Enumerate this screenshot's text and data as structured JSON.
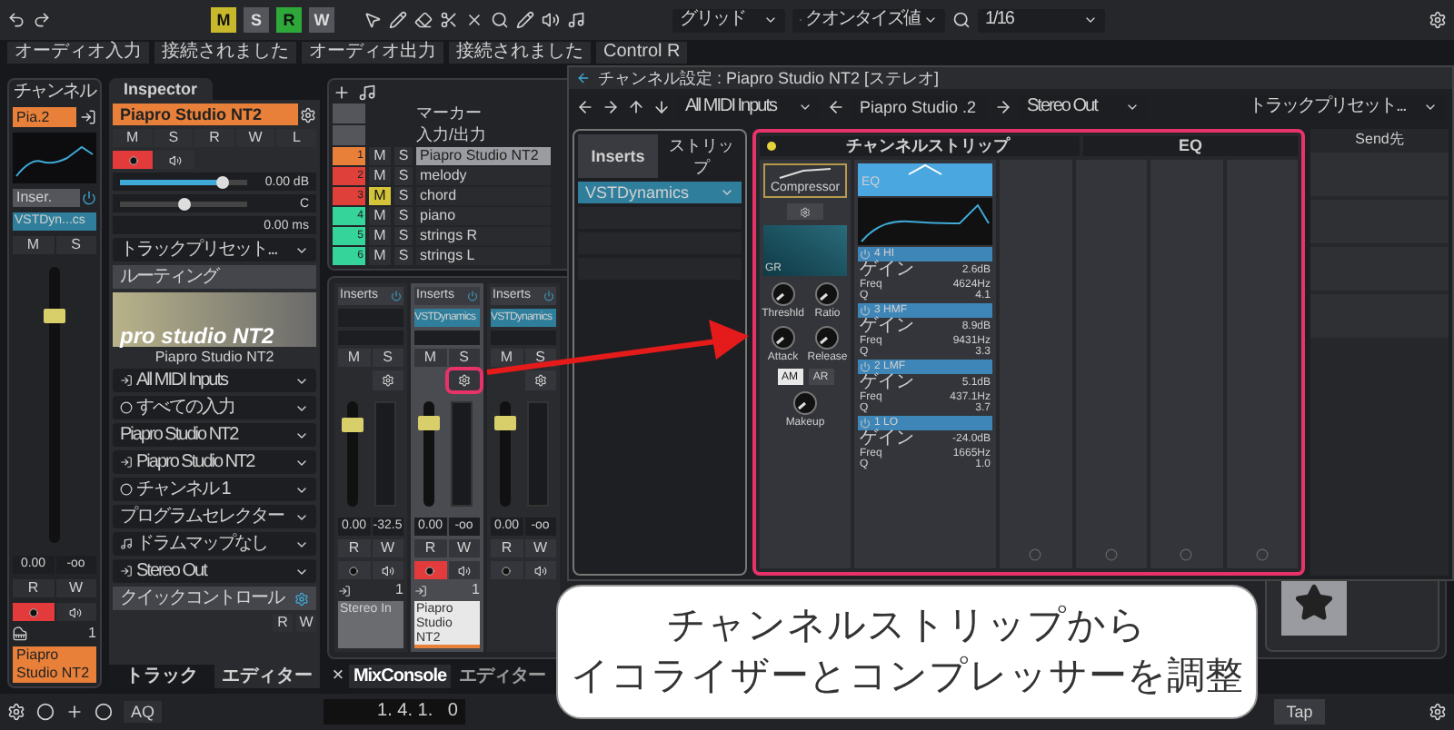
{
  "toolbar": {
    "buttons": [
      {
        "label": "M",
        "on": true,
        "color": "#c8b92c"
      },
      {
        "label": "S",
        "on": false
      },
      {
        "label": "R",
        "on": true,
        "color": "#2fa83a"
      },
      {
        "label": "W",
        "on": false
      }
    ],
    "grid": "グリッド",
    "quantize_type": "クオンタイズ値",
    "quantize": "1/16"
  },
  "status": [
    "オーディオ入力",
    "接続されました",
    "オーディオ出力",
    "接続されました",
    "Control R"
  ],
  "channel": {
    "title": "チャンネル",
    "name": "Pia.2",
    "inserts": "Inser.",
    "insert": "VSTDyn...cs",
    "mute": "M",
    "solo": "S",
    "fader": {
      "level": 0.82
    },
    "volume": "0.00",
    "peak": "-oo",
    "read": "R",
    "write": "W",
    "record": true,
    "number": "1",
    "track": "Piapro Studio NT2"
  },
  "inspector": {
    "tab": "Inspector",
    "track": "Piapro Studio NT2",
    "buttons": [
      "M",
      "S",
      "R",
      "W",
      "L"
    ],
    "record": true,
    "volume": {
      "level": 0.8,
      "reading": "0.00 dB"
    },
    "pan": {
      "level": 0.5,
      "reading": "C"
    },
    "delay": "0.00 ms",
    "preset": "トラックプリセット...",
    "routing": "ルーティング",
    "logo": "pro studio NT2",
    "logo_caption": "Piapro Studio NT2",
    "fields": [
      "All MIDI Inputs",
      "すべての入力",
      "Piapro Studio NT2",
      "Piapro Studio NT2",
      "チャンネル 1",
      "プログラムセレクター",
      "ドラムマップなし",
      "Stereo Out"
    ],
    "quick_controls": "クイックコントロール",
    "qc_buttons": [
      "R",
      "W"
    ]
  },
  "left_tabs": [
    {
      "label": "トラック",
      "selected": false
    },
    {
      "label": "エディター",
      "selected": true
    }
  ],
  "track_list": {
    "header_rows": [
      "マーカー",
      "入力/出力"
    ],
    "tracks": [
      {
        "number": "1",
        "name": "Piapro Studio NT2",
        "color": "#e8803a",
        "selected": true,
        "mute": "M",
        "mute_on": false,
        "solo": "S"
      },
      {
        "number": "2",
        "name": "melody",
        "color": "#e0403a",
        "selected": false,
        "mute": "M",
        "mute_on": false,
        "solo": "S"
      },
      {
        "number": "3",
        "name": "chord",
        "color": "#e0403a",
        "selected": false,
        "mute": "M",
        "mute_on": true,
        "solo": "S"
      },
      {
        "number": "4",
        "name": "piano",
        "color": "#35d49a",
        "selected": false,
        "mute": "M",
        "mute_on": false,
        "solo": "S"
      },
      {
        "number": "5",
        "name": "strings R",
        "color": "#35d49a",
        "selected": false,
        "mute": "M",
        "mute_on": false,
        "solo": "S"
      },
      {
        "number": "6",
        "name": "strings L",
        "color": "#35d49a",
        "selected": false,
        "mute": "M",
        "mute_on": false,
        "solo": "S"
      }
    ]
  },
  "mixer": {
    "channels": [
      {
        "inserts": "Inserts",
        "mute": "M",
        "solo": "S",
        "highlighted": false,
        "fader": {
          "level": 0.78
        },
        "volume": "0.00",
        "peak": "-32.5",
        "read": "R",
        "write": "W",
        "record": false,
        "number": "1",
        "name": "Stereo In",
        "selected": false
      },
      {
        "inserts": "Inserts",
        "insert": "VSTDynamics",
        "mute": "M",
        "solo": "S",
        "highlighted": true,
        "fader": {
          "level": 0.8
        },
        "volume": "0.00",
        "peak": "-oo",
        "read": "R",
        "write": "W",
        "record": true,
        "number": "1",
        "name": "Piapro Studio NT2",
        "selected": true
      },
      {
        "inserts": "Inserts",
        "insert": "VSTDynamics",
        "mute": "M",
        "solo": "S",
        "highlighted": false,
        "fader": {
          "level": 0.8
        },
        "volume": "0.00",
        "peak": "-oo",
        "read": "R",
        "write": "W",
        "record": false,
        "selected": false
      }
    ]
  },
  "bottom_tabs": {
    "close": "×",
    "tabs": [
      {
        "label": "MixConsole",
        "selected": true
      },
      {
        "label": "エディター",
        "selected": false
      }
    ]
  },
  "channel_settings": {
    "title": "チャンネル設定 : Piapro Studio NT2 [ステレオ]",
    "input": "All MIDI Inputs",
    "instrument": "Piapro Studio .2",
    "output": "Stereo Out",
    "preset": "トラックプリセット...",
    "tabs": [
      {
        "label": "Inserts",
        "selected": true
      },
      {
        "label": "ストリップ",
        "selected": false
      }
    ],
    "slot": "VSTDynamics",
    "strip_title": "チャンネルストリップ",
    "eq_title": "EQ",
    "sends_title": "Send先",
    "compressor": {
      "name": "Compressor",
      "graph_label": "GR",
      "knobs": [
        "Threshld",
        "Ratio",
        "Attack",
        "Release"
      ],
      "buttons": [
        {
          "label": "AM",
          "on": true
        },
        {
          "label": "AR",
          "on": false
        }
      ],
      "makeup": "Makeup"
    },
    "eq": {
      "name": "EQ",
      "bands": [
        {
          "name": "4 HI",
          "rows": [
            {
              "label": "ゲイン",
              "value": "2.6dB"
            },
            {
              "label": "Freq",
              "value": "4624Hz"
            },
            {
              "label": "Q",
              "value": "4.1"
            }
          ]
        },
        {
          "name": "3 HMF",
          "rows": [
            {
              "label": "ゲイン",
              "value": "8.9dB"
            },
            {
              "label": "Freq",
              "value": "9431Hz"
            },
            {
              "label": "Q",
              "value": "3.3"
            }
          ]
        },
        {
          "name": "2 LMF",
          "rows": [
            {
              "label": "ゲイン",
              "value": "5.1dB"
            },
            {
              "label": "Freq",
              "value": "437.1Hz"
            },
            {
              "label": "Q",
              "value": "3.7"
            }
          ]
        },
        {
          "name": "1 LO",
          "rows": [
            {
              "label": "ゲイン",
              "value": "-24.0dB"
            },
            {
              "label": "Freq",
              "value": "1665Hz"
            },
            {
              "label": "Q",
              "value": "1.0"
            }
          ]
        }
      ]
    }
  },
  "callout": [
    "チャンネルストリップから",
    "イコライザーとコンプレッサーを調整"
  ],
  "transport": {
    "aq": "AQ",
    "position": "1. 4. 1.   0",
    "tap": "Tap"
  }
}
